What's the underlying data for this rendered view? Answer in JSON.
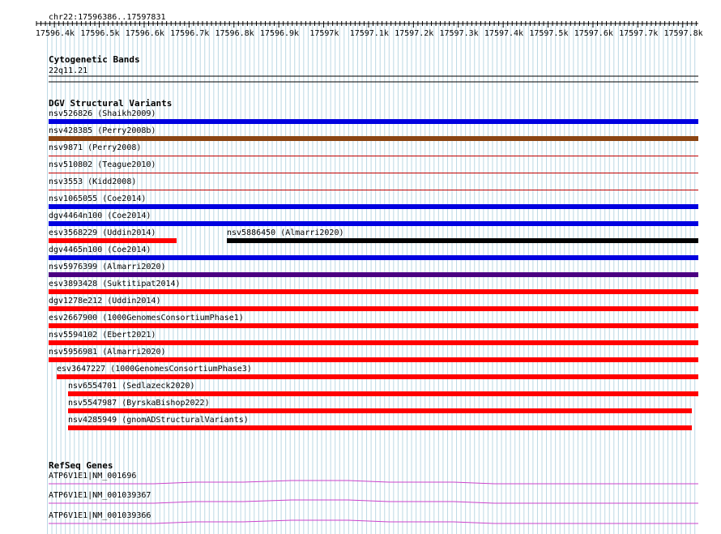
{
  "coord_label": "chr22:17596386..17597831",
  "ruler": {
    "ticks": [
      "17596.4k",
      "17596.5k",
      "17596.6k",
      "17596.7k",
      "17596.8k",
      "17596.9k",
      "17597k",
      "17597.1k",
      "17597.2k",
      "17597.3k",
      "17597.4k",
      "17597.5k",
      "17597.6k",
      "17597.7k",
      "17597.8k"
    ]
  },
  "tracks": {
    "cytogenetic": {
      "title": "Cytogenetic Bands",
      "band": "22q11.21"
    },
    "dgv": {
      "title": "DGV Structural Variants",
      "variants": [
        {
          "id": "nsv526826",
          "study": "(Shaikh2009)",
          "color": "#0000e0"
        },
        {
          "id": "nsv428385",
          "study": "(Perry2008b)",
          "color": "#8b4513"
        },
        {
          "id": "nsv9871",
          "study": "(Perry2008)",
          "color": "#c00000"
        },
        {
          "id": "nsv510802",
          "study": "(Teague2010)",
          "color": "#c00000"
        },
        {
          "id": "nsv3553",
          "study": "(Kidd2008)",
          "color": "#c00000"
        },
        {
          "id": "nsv1065055",
          "study": "(Coe2014)",
          "color": "#0000e0"
        },
        {
          "id": "dgv4464n100",
          "study": "(Coe2014)",
          "color": "#0000e0"
        },
        {
          "id": "esv3568229",
          "study": "(Uddin2014)",
          "color": "#ff0000"
        },
        {
          "id": "nsv5886450",
          "study": "(Almarri2020)",
          "color": "#000000"
        },
        {
          "id": "dgv4465n100",
          "study": "(Coe2014)",
          "color": "#0000e0"
        },
        {
          "id": "nsv5976399",
          "study": "(Almarri2020)",
          "color": "#4b0082"
        },
        {
          "id": "esv3893428",
          "study": "(Suktitipat2014)",
          "color": "#ff0000"
        },
        {
          "id": "dgv1278e212",
          "study": "(Uddin2014)",
          "color": "#ff0000"
        },
        {
          "id": "esv2667900",
          "study": "(1000GenomesConsortiumPhase1)",
          "color": "#ff0000"
        },
        {
          "id": "nsv5594102",
          "study": "(Ebert2021)",
          "color": "#ff0000"
        },
        {
          "id": "nsv5956981",
          "study": "(Almarri2020)",
          "color": "#ff0000"
        },
        {
          "id": "esv3647227",
          "study": "(1000GenomesConsortiumPhase3)",
          "color": "#ff0000"
        },
        {
          "id": "nsv6554701",
          "study": "(Sedlazeck2020)",
          "color": "#ff0000"
        },
        {
          "id": "nsv5547987",
          "study": "(ByrskaBishop2022)",
          "color": "#ff0000"
        },
        {
          "id": "nsv4285949",
          "study": "(gnomADStructuralVariants)",
          "color": "#ff0000"
        }
      ]
    },
    "refseq": {
      "title": "RefSeq Genes",
      "genes": [
        {
          "label": "ATP6V1E1|NM_001696",
          "color": "#cc44cc"
        },
        {
          "label": "ATP6V1E1|NM_001039367",
          "color": "#cc44cc"
        },
        {
          "label": "ATP6V1E1|NM_001039366",
          "color": "#cc44cc"
        }
      ]
    }
  }
}
